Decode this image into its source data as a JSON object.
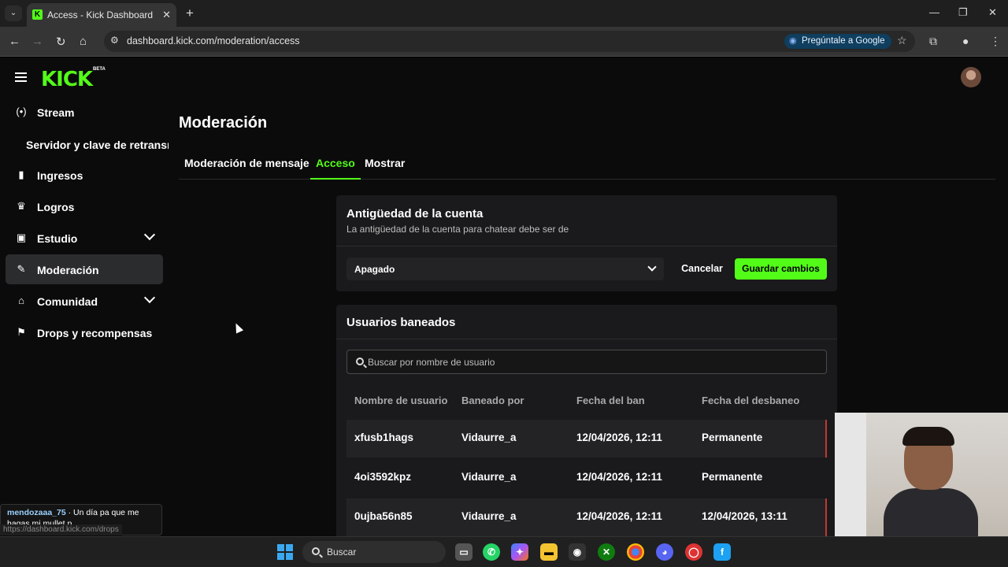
{
  "browser": {
    "tab_title": "Access - Kick Dashboard",
    "tab_favicon": "K",
    "url": "dashboard.kick.com/moderation/access",
    "ask_google": "Pregúntale a Google"
  },
  "header": {
    "logo": "KICK",
    "beta": "BETA"
  },
  "sidebar": {
    "items": [
      {
        "label": "Stream",
        "icon": "(•)"
      },
      {
        "label": "Servidor y clave de retransmisión"
      },
      {
        "label": "Ingresos",
        "icon": "▮"
      },
      {
        "label": "Logros",
        "icon": "🏆"
      },
      {
        "label": "Estudio",
        "icon": "▣"
      },
      {
        "label": "Moderación",
        "icon": "🔧"
      },
      {
        "label": "Comunidad",
        "icon": "⌂"
      },
      {
        "label": "Drops y recompensas",
        "icon": "⚑"
      }
    ]
  },
  "main": {
    "title": "Moderación",
    "tabs": [
      {
        "label": "Moderación de mensaje"
      },
      {
        "label": "Acceso"
      },
      {
        "label": "Mostrar"
      }
    ]
  },
  "account_age": {
    "title": "Antigüedad de la cuenta",
    "subtitle": "La antigüedad de la cuenta para chatear debe ser de",
    "selected": "Apagado",
    "cancel": "Cancelar",
    "save": "Guardar cambios"
  },
  "banned": {
    "title": "Usuarios baneados",
    "search_placeholder": "Buscar por nombre de usuario",
    "columns": [
      "Nombre de usuario",
      "Baneado por",
      "Fecha del ban",
      "Fecha del desbaneo"
    ],
    "rows": [
      [
        "xfusb1hags",
        "Vidaurre_a",
        "12/04/2026, 12:11",
        "Permanente"
      ],
      [
        "4oi3592kpz",
        "Vidaurre_a",
        "12/04/2026, 12:11",
        "Permanente"
      ],
      [
        "0ujba56n85",
        "Vidaurre_a",
        "12/04/2026, 12:11",
        "12/04/2026, 13:11"
      ]
    ]
  },
  "chat_popup": {
    "user": "mendozaaa_75",
    "message": "· Un día pa que me hagas mi mullet p"
  },
  "status_url": "https://dashboard.kick.com/drops",
  "taskbar": {
    "search_label": "Buscar"
  },
  "colors": {
    "accent": "#53fc18",
    "background": "#0b0b0c",
    "card": "#1a1a1c"
  }
}
